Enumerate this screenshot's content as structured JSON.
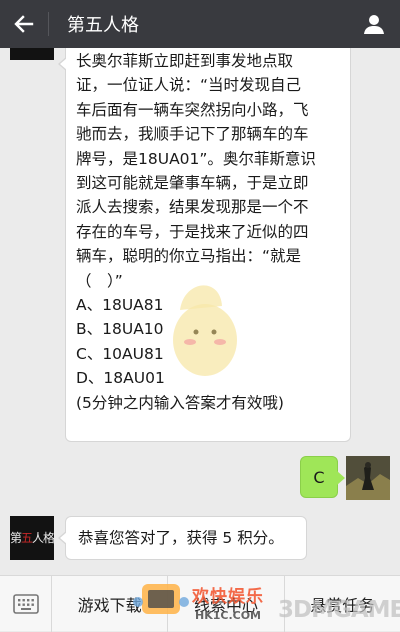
{
  "header": {
    "title": "第五人格",
    "back_icon": "arrow-left-icon",
    "profile_icon": "person-icon"
  },
  "messages": {
    "official_avatar_logo": "第五人格",
    "question_lines": [
      "长奥尔菲斯立即赶到事发地点取",
      "证，一位证人说：“当时发现自己",
      "车后面有一辆车突然拐向小路，飞",
      "驰而去，我顺手记下了那辆车的车",
      "牌号，是18UA01”。奥尔菲斯意识",
      "到这可能就是肇事车辆，于是立即",
      "派人去搜索，结果发现那是一个不",
      "存在的车号，于是找来了近似的四",
      "辆车，聪明的你立马指出：“就是",
      "（　）”",
      "A、18UA81",
      "B、18UA10",
      "C、10AU81",
      "D、18AU01",
      "(5分钟之内输入答案才有效哦)"
    ],
    "user_answer": "C",
    "reply": "恭喜您答对了，获得 5 积分。"
  },
  "bottom_menu": {
    "keyboard_icon": "keyboard-icon",
    "items": [
      "游戏下载",
      "线索中心",
      "悬赏任务"
    ]
  },
  "watermark": {
    "line1": "欢快娱乐",
    "line2": "HK1C.COM",
    "line3": "3DMGAME"
  },
  "colors": {
    "topbar": "#393a3f",
    "chat_background": "#ebebeb",
    "user_bubble": "#9fe658"
  }
}
